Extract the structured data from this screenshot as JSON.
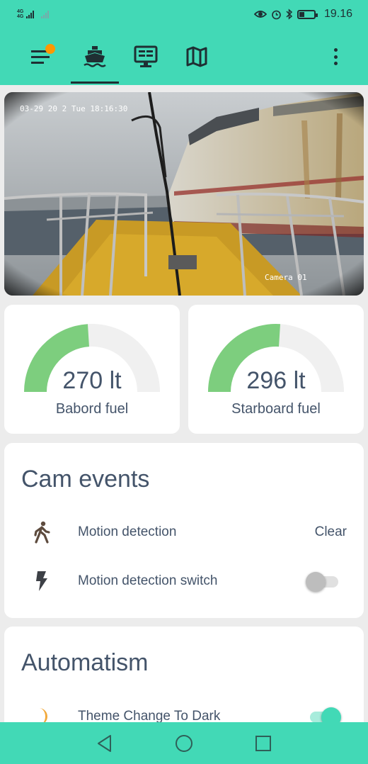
{
  "status_bar": {
    "network_top": "4G",
    "network_bottom": "4G",
    "time": "19.16",
    "battery_level": 0.35
  },
  "app_bar": {
    "menu_icon": "menu-icon",
    "tabs": [
      {
        "icon": "ferry-icon",
        "active": true
      },
      {
        "icon": "monitor-icon",
        "active": false
      },
      {
        "icon": "map-icon",
        "active": false
      }
    ],
    "more_icon": "more-vertical-icon",
    "accent": "#42d9b6",
    "badge_color": "#ff9800"
  },
  "camera": {
    "timestamp": "03-29 20 2 Tue 18:16:30",
    "camera_label": "Camera 01"
  },
  "gauges": [
    {
      "value": "270 lt",
      "label": "Babord fuel",
      "fraction": 0.48,
      "color": "#7dce7e"
    },
    {
      "value": "296 lt",
      "label": "Starboard fuel",
      "fraction": 0.52,
      "color": "#7dce7e"
    }
  ],
  "cam_events": {
    "title": "Cam events",
    "rows": [
      {
        "icon": "walk-icon",
        "label": "Motion detection",
        "state": "Clear"
      },
      {
        "icon": "flash-icon",
        "label": "Motion detection switch",
        "toggle_on": false
      }
    ]
  },
  "automatism": {
    "title": "Automatism",
    "rows": [
      {
        "icon": "moon-icon",
        "label": "Theme Change To Dark",
        "toggle_on": true
      }
    ]
  },
  "system_nav": {
    "back_icon": "back-triangle-icon",
    "home_icon": "home-circle-icon",
    "recents_icon": "recents-square-icon"
  }
}
